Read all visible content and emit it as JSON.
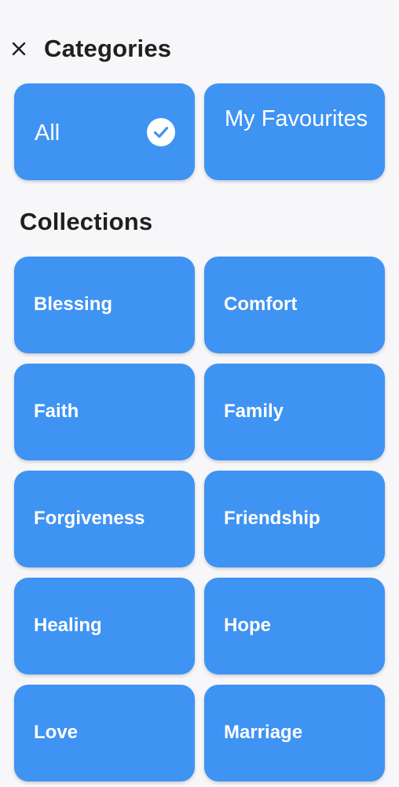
{
  "header": {
    "title": "Categories",
    "close_icon": "close-icon"
  },
  "top_cards": {
    "all": {
      "label": "All",
      "selected": true
    },
    "favourites": {
      "label": "My Favourites",
      "selected": false
    }
  },
  "collections": {
    "title": "Collections",
    "items": [
      {
        "label": "Blessing"
      },
      {
        "label": "Comfort"
      },
      {
        "label": "Faith"
      },
      {
        "label": "Family"
      },
      {
        "label": "Forgiveness"
      },
      {
        "label": "Friendship"
      },
      {
        "label": "Healing"
      },
      {
        "label": "Hope"
      },
      {
        "label": "Love"
      },
      {
        "label": "Marriage"
      }
    ]
  },
  "colors": {
    "card": "#3f93f2",
    "background": "#f7f7fa",
    "text_dark": "#1f1f1f",
    "text_light": "#ffffff"
  }
}
